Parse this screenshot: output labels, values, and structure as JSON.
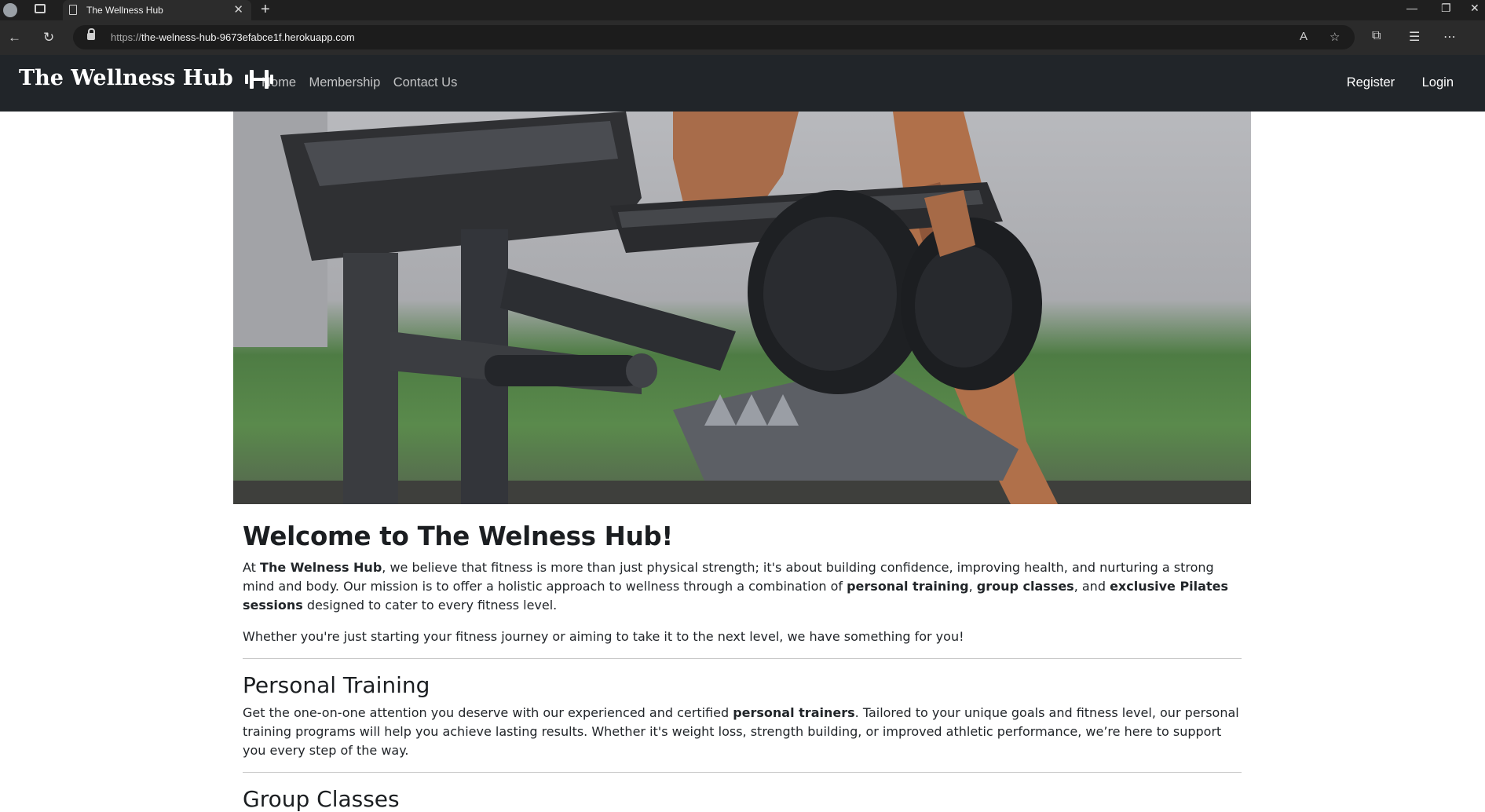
{
  "browser": {
    "tab_title": "The Wellness Hub",
    "url_scheme": "https://",
    "url_host": "the-welness-hub-9673efabce1f.herokuapp.com"
  },
  "site": {
    "brand": "The Wellness Hub",
    "nav": {
      "home": "Home",
      "membership": "Membership",
      "contact": "Contact Us"
    },
    "auth": {
      "register": "Register",
      "login": "Login"
    }
  },
  "hero": {
    "subject": "gym bench with dumbbells"
  },
  "welcome": {
    "heading": "Welcome to The Welness Hub!",
    "p1_a": "At ",
    "p1_b": "The Welness Hub",
    "p1_c": ", we believe that fitness is more than just physical strength; it's about building confidence, improving health, and nurturing a strong mind and body. Our mission is to offer a holistic approach to wellness through a combination of ",
    "p1_d": "personal training",
    "p1_e": ", ",
    "p1_f": "group classes",
    "p1_g": ", and ",
    "p1_h": "exclusive Pilates sessions",
    "p1_i": " designed to cater to every fitness level.",
    "p2": "Whether you're just starting your fitness journey or aiming to take it to the next level, we have something for you!"
  },
  "personal_training": {
    "heading": "Personal Training",
    "p_a": "Get the one-on-one attention you deserve with our experienced and certified ",
    "p_b": "personal trainers",
    "p_c": ". Tailored to your unique goals and fitness level, our personal training programs will help you achieve lasting results. Whether it's weight loss, strength building, or improved athletic performance, we’re here to support you every step of the way."
  },
  "group_classes": {
    "heading": "Group Classes"
  }
}
